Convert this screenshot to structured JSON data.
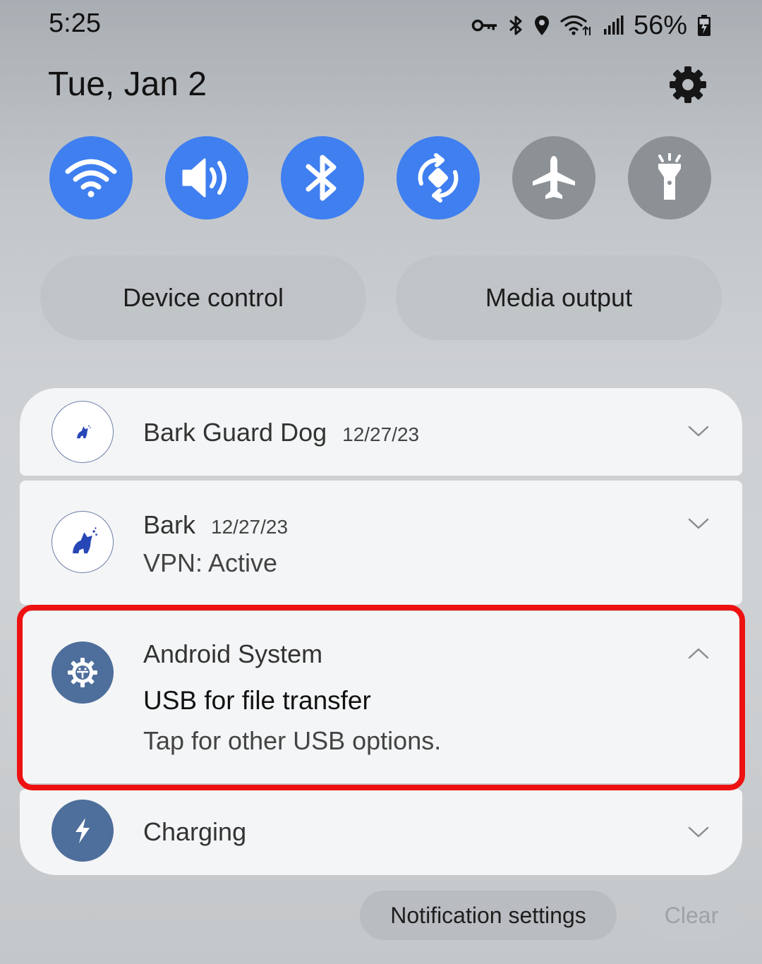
{
  "status_bar": {
    "time": "5:25",
    "battery_percent": "56%",
    "icons": [
      "vpn-key-icon",
      "bluetooth-icon",
      "location-icon",
      "wifi-icon",
      "signal-icon",
      "battery-charging-icon"
    ]
  },
  "header": {
    "date": "Tue, Jan 2",
    "settings_icon": "gear-icon"
  },
  "quick_tiles": [
    {
      "name": "wifi",
      "icon": "wifi-icon",
      "state": "on"
    },
    {
      "name": "sound",
      "icon": "volume-icon",
      "state": "on"
    },
    {
      "name": "bluetooth",
      "icon": "bluetooth-icon",
      "state": "on"
    },
    {
      "name": "auto-rotate",
      "icon": "rotate-icon",
      "state": "on"
    },
    {
      "name": "airplane-mode",
      "icon": "airplane-icon",
      "state": "off"
    },
    {
      "name": "flashlight",
      "icon": "flashlight-icon",
      "state": "off"
    }
  ],
  "pills": {
    "device_control": "Device control",
    "media_output": "Media output"
  },
  "notifications": [
    {
      "app": "Bark Guard Dog",
      "time": "12/27/23",
      "icon": "dog-icon"
    },
    {
      "app": "Bark",
      "time": "12/27/23",
      "text": "VPN: Active",
      "icon": "dog-icon"
    },
    {
      "app": "Android System",
      "title": "USB for file transfer",
      "text": "Tap for other USB options.",
      "icon": "android-system-icon",
      "expanded": true
    },
    {
      "app": "Charging",
      "icon": "lightning-icon"
    }
  ],
  "footer": {
    "notification_settings": "Notification settings",
    "clear": "Clear"
  },
  "colors": {
    "tile_on": "#3f7ff0",
    "tile_off": "#8c9196",
    "highlight": "#ee1111",
    "app_icon_blue": "#4e6e9b"
  }
}
